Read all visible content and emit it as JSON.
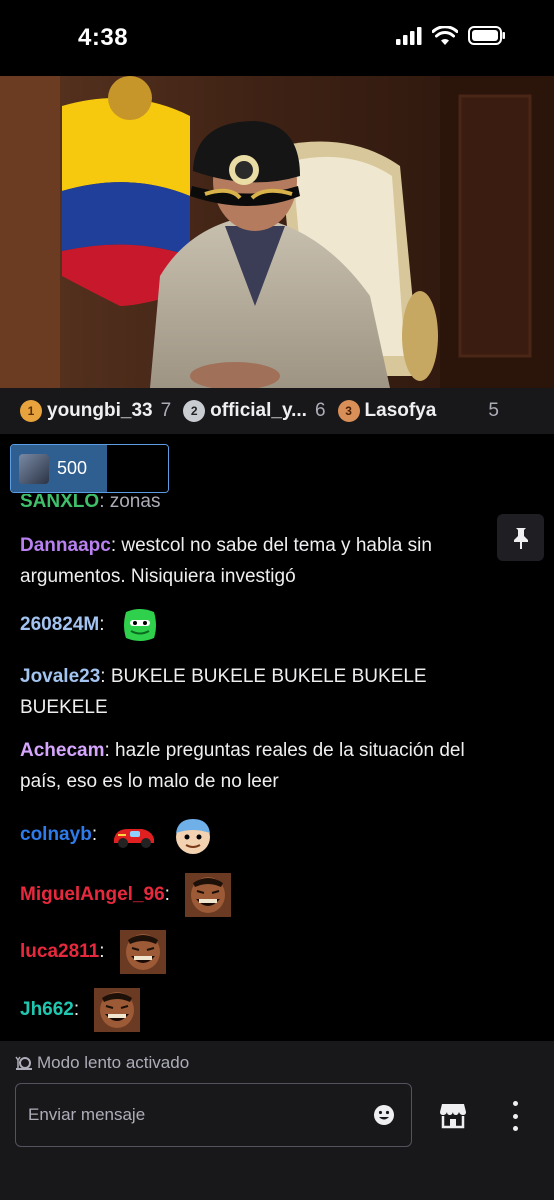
{
  "status_bar": {
    "time": "4:38"
  },
  "leaderboard": [
    {
      "rank": "1",
      "name": "youngbi_33",
      "count": "7",
      "badge_color": "#e8a33d"
    },
    {
      "rank": "2",
      "name": "official_y...",
      "count": "6",
      "badge_color": "#c9ccd1"
    },
    {
      "rank": "3",
      "name": "Lasofya",
      "count": "5",
      "badge_color": "#d98f58"
    }
  ],
  "hype": {
    "amount": "500"
  },
  "chat": {
    "partial_top": {
      "user": "SANXLO",
      "text": ": zonas"
    },
    "messages": [
      {
        "user": "Dannaapc",
        "color": "#b980f0",
        "text": ": westcol no sabe del tema y habla sin argumentos. Nisiquiera investigó"
      },
      {
        "user": "260824M",
        "color": "#a3c4f0",
        "text": ":",
        "emotes": [
          "pepe-emote"
        ]
      },
      {
        "user": "Jovale23",
        "color": "#a3c4f0",
        "text": ": BUKELE BUKELE BUKELE BUKELE BUEKELE"
      },
      {
        "user": "Achecam",
        "color": "#d6a6ff",
        "text": ": hazle preguntas reales de la situación del país, eso es lo malo de no leer"
      },
      {
        "user": "colnayb",
        "color": "#2e7bea",
        "text": ":",
        "emotes": [
          "race-car-emote",
          "cartoon-face-emote"
        ]
      },
      {
        "user": "MiguelAngel_96",
        "color": "#e8293d",
        "text": ":",
        "emotes": [
          "laughing-man-emote"
        ]
      },
      {
        "user": "luca2811",
        "color": "#e8293d",
        "text": ":",
        "emotes": [
          "laughing-man-emote"
        ]
      },
      {
        "user": "Jh662",
        "color": "#1fc7b0",
        "text": ":",
        "emotes": [
          "laughing-man-emote"
        ]
      }
    ]
  },
  "footer": {
    "slow_mode": "Modo lento activado",
    "input_placeholder": "Enviar mensaje"
  }
}
